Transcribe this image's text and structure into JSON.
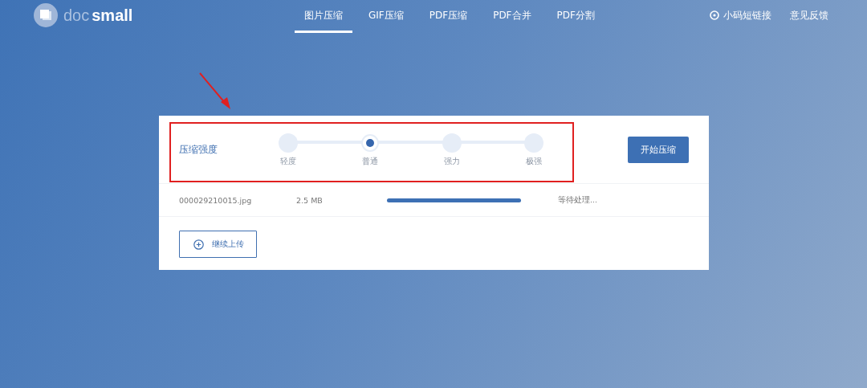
{
  "header": {
    "logo": {
      "light": "doc",
      "bold": "small"
    },
    "nav": [
      {
        "label": "图片压缩",
        "selected": true
      },
      {
        "label": "GIF压缩",
        "selected": false
      },
      {
        "label": "PDF压缩",
        "selected": false
      },
      {
        "label": "PDF合并",
        "selected": false
      },
      {
        "label": "PDF分割",
        "selected": false
      }
    ],
    "links": [
      {
        "label": "小码短链接",
        "kind": "icon"
      },
      {
        "label": "意见反馈",
        "kind": "plain"
      }
    ]
  },
  "panel": {
    "strength_label": "压缩强度",
    "levels": [
      {
        "label": "轻度",
        "selected": false
      },
      {
        "label": "普通",
        "selected": true
      },
      {
        "label": "强力",
        "selected": false
      },
      {
        "label": "极强",
        "selected": false
      }
    ],
    "start_button": "开始压缩",
    "files": [
      {
        "name": "000029210015.jpg",
        "size": "2.5 MB",
        "level": 1,
        "status": "等待处理..."
      }
    ],
    "upload_button": "继续上传"
  }
}
